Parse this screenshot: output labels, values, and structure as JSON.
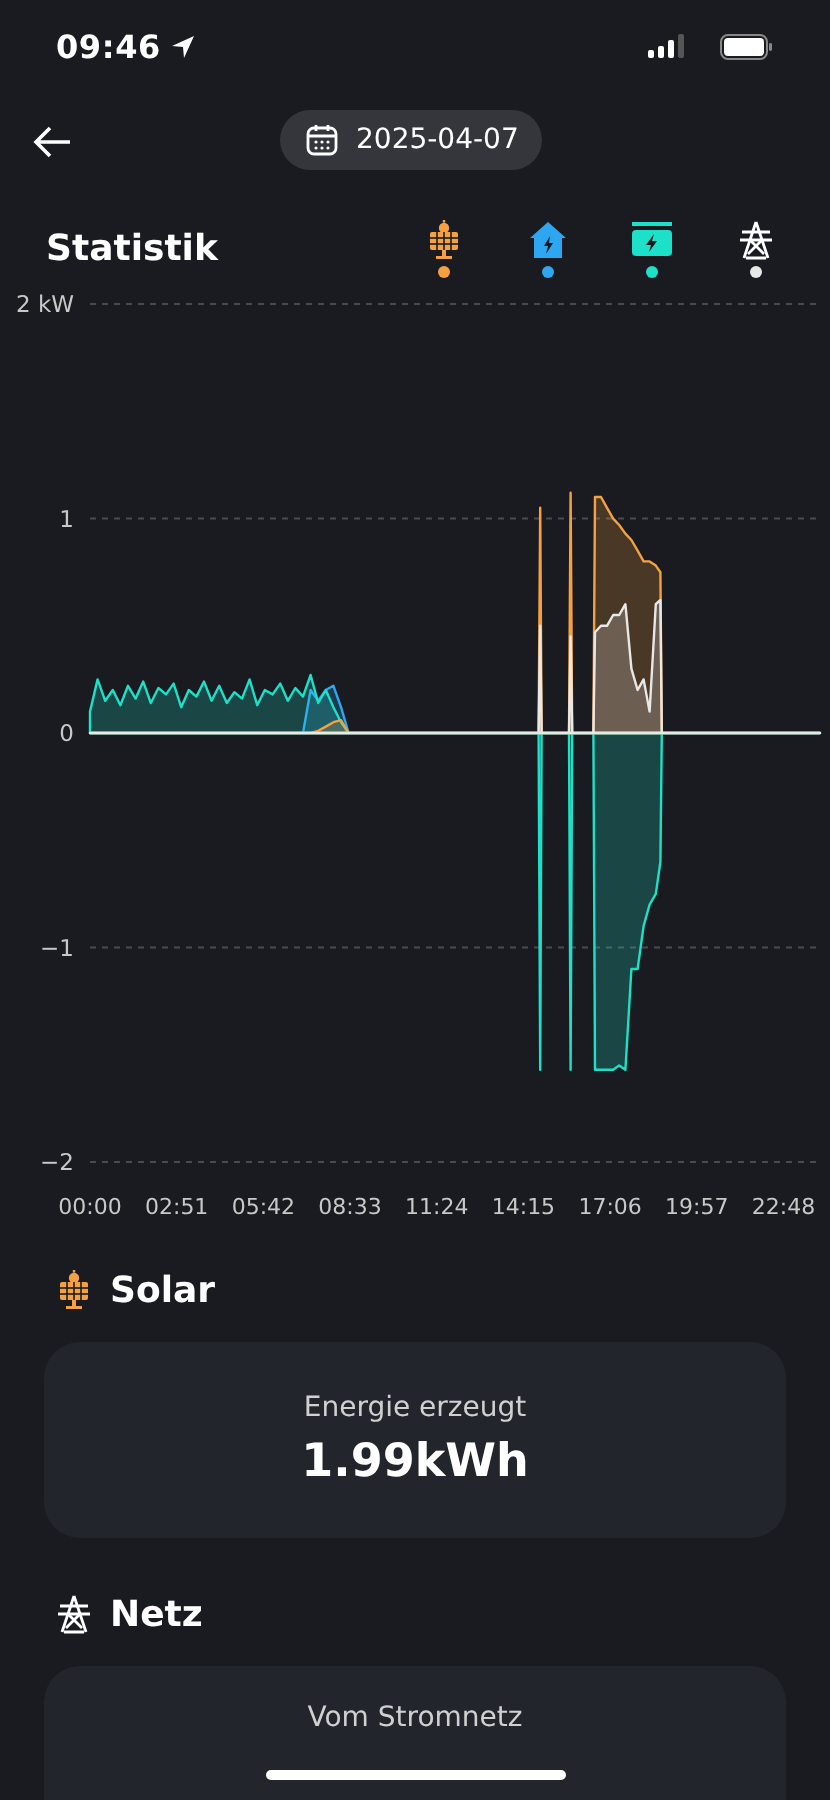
{
  "status_bar": {
    "time": "09:46"
  },
  "header": {
    "date": "2025-04-07"
  },
  "statistics": {
    "title": "Statistik",
    "legend": [
      {
        "kind": "solar",
        "color": "#f5a142"
      },
      {
        "kind": "home",
        "color": "#2ea7f2"
      },
      {
        "kind": "battery",
        "color": "#1de0c8"
      },
      {
        "kind": "grid",
        "color": "#e8e8e8"
      }
    ],
    "chart_data": {
      "type": "area",
      "xlim": [
        0,
        24
      ],
      "ylim": [
        -2,
        2
      ],
      "yticks": [
        {
          "value": 2,
          "label": "2 kW"
        },
        {
          "value": 1,
          "label": "1"
        },
        {
          "value": 0,
          "label": "0"
        },
        {
          "value": -1,
          "label": "−1"
        },
        {
          "value": -2,
          "label": "−2"
        }
      ],
      "xticks": [
        {
          "value": 0,
          "label": "00:00"
        },
        {
          "value": 2.85,
          "label": "02:51"
        },
        {
          "value": 5.7,
          "label": "05:42"
        },
        {
          "value": 8.55,
          "label": "08:33"
        },
        {
          "value": 11.4,
          "label": "11:24"
        },
        {
          "value": 14.25,
          "label": "14:15"
        },
        {
          "value": 17.1,
          "label": "17:06"
        },
        {
          "value": 19.95,
          "label": "19:57"
        },
        {
          "value": 22.8,
          "label": "22:48"
        }
      ],
      "x": [
        0,
        0.25,
        0.5,
        0.75,
        1,
        1.25,
        1.5,
        1.75,
        2,
        2.25,
        2.5,
        2.75,
        3,
        3.25,
        3.5,
        3.75,
        4,
        4.25,
        4.5,
        4.75,
        5,
        5.25,
        5.5,
        5.75,
        6,
        6.25,
        6.5,
        6.75,
        7,
        7.25,
        7.5,
        7.75,
        8,
        8.25,
        8.5,
        14.75,
        14.8,
        14.85,
        15.75,
        15.8,
        15.85,
        16.55,
        16.6,
        16.8,
        17,
        17.2,
        17.4,
        17.6,
        17.8,
        18,
        18.2,
        18.4,
        18.6,
        18.75,
        18.8,
        24
      ],
      "series": [
        {
          "color": "#2ea7f2",
          "values": [
            0,
            0,
            0,
            0,
            0,
            0,
            0,
            0,
            0,
            0,
            0,
            0,
            0,
            0,
            0,
            0,
            0,
            0,
            0,
            0,
            0,
            0,
            0,
            0,
            0,
            0,
            0,
            0,
            0,
            0.2,
            0.15,
            0.2,
            0.22,
            0.12,
            0,
            0,
            0,
            0,
            0,
            0,
            0,
            0,
            0,
            0,
            0,
            0,
            0,
            0,
            0,
            0,
            0,
            0,
            0,
            0,
            0,
            0
          ]
        },
        {
          "color": "#1de0c8",
          "values": [
            0.1,
            0.25,
            0.15,
            0.2,
            0.13,
            0.22,
            0.16,
            0.24,
            0.14,
            0.21,
            0.18,
            0.23,
            0.12,
            0.2,
            0.17,
            0.24,
            0.15,
            0.22,
            0.14,
            0.19,
            0.16,
            0.25,
            0.13,
            0.2,
            0.18,
            0.23,
            0.15,
            0.21,
            0.17,
            0.27,
            0.14,
            0.2,
            0.12,
            0.05,
            0,
            0,
            -1.57,
            0,
            0,
            -1.57,
            0,
            0,
            -1.57,
            -1.57,
            -1.57,
            -1.57,
            -1.55,
            -1.57,
            -1.1,
            -1.1,
            -0.9,
            -0.8,
            -0.75,
            -0.6,
            0,
            0
          ]
        },
        {
          "color": "#f5a142",
          "values": [
            0,
            0,
            0,
            0,
            0,
            0,
            0,
            0,
            0,
            0,
            0,
            0,
            0,
            0,
            0,
            0,
            0,
            0,
            0,
            0,
            0,
            0,
            0,
            0,
            0,
            0,
            0,
            0,
            0,
            0,
            0.01,
            0.03,
            0.05,
            0.06,
            0,
            0,
            1.05,
            0,
            0,
            1.12,
            0,
            0,
            1.1,
            1.1,
            1.05,
            1,
            0.97,
            0.93,
            0.9,
            0.85,
            0.8,
            0.8,
            0.78,
            0.75,
            0,
            0
          ]
        },
        {
          "color": "#e8e8e8",
          "values": [
            0,
            0,
            0,
            0,
            0,
            0,
            0,
            0,
            0,
            0,
            0,
            0,
            0,
            0,
            0,
            0,
            0,
            0,
            0,
            0,
            0,
            0,
            0,
            0,
            0,
            0,
            0,
            0,
            0,
            0,
            0,
            0,
            0,
            0,
            0,
            0,
            0.5,
            0,
            0,
            0.45,
            0,
            0,
            0.47,
            0.5,
            0.5,
            0.55,
            0.55,
            0.6,
            0.3,
            0.2,
            0.25,
            0.1,
            0.6,
            0.62,
            0,
            0
          ]
        }
      ]
    }
  },
  "sections": [
    {
      "kind": "solar",
      "title": "Solar",
      "card": {
        "label": "Energie erzeugt",
        "value": "1.99kWh"
      }
    },
    {
      "kind": "grid",
      "title": "Netz",
      "card": {
        "label": "Vom Stromnetz"
      }
    }
  ]
}
